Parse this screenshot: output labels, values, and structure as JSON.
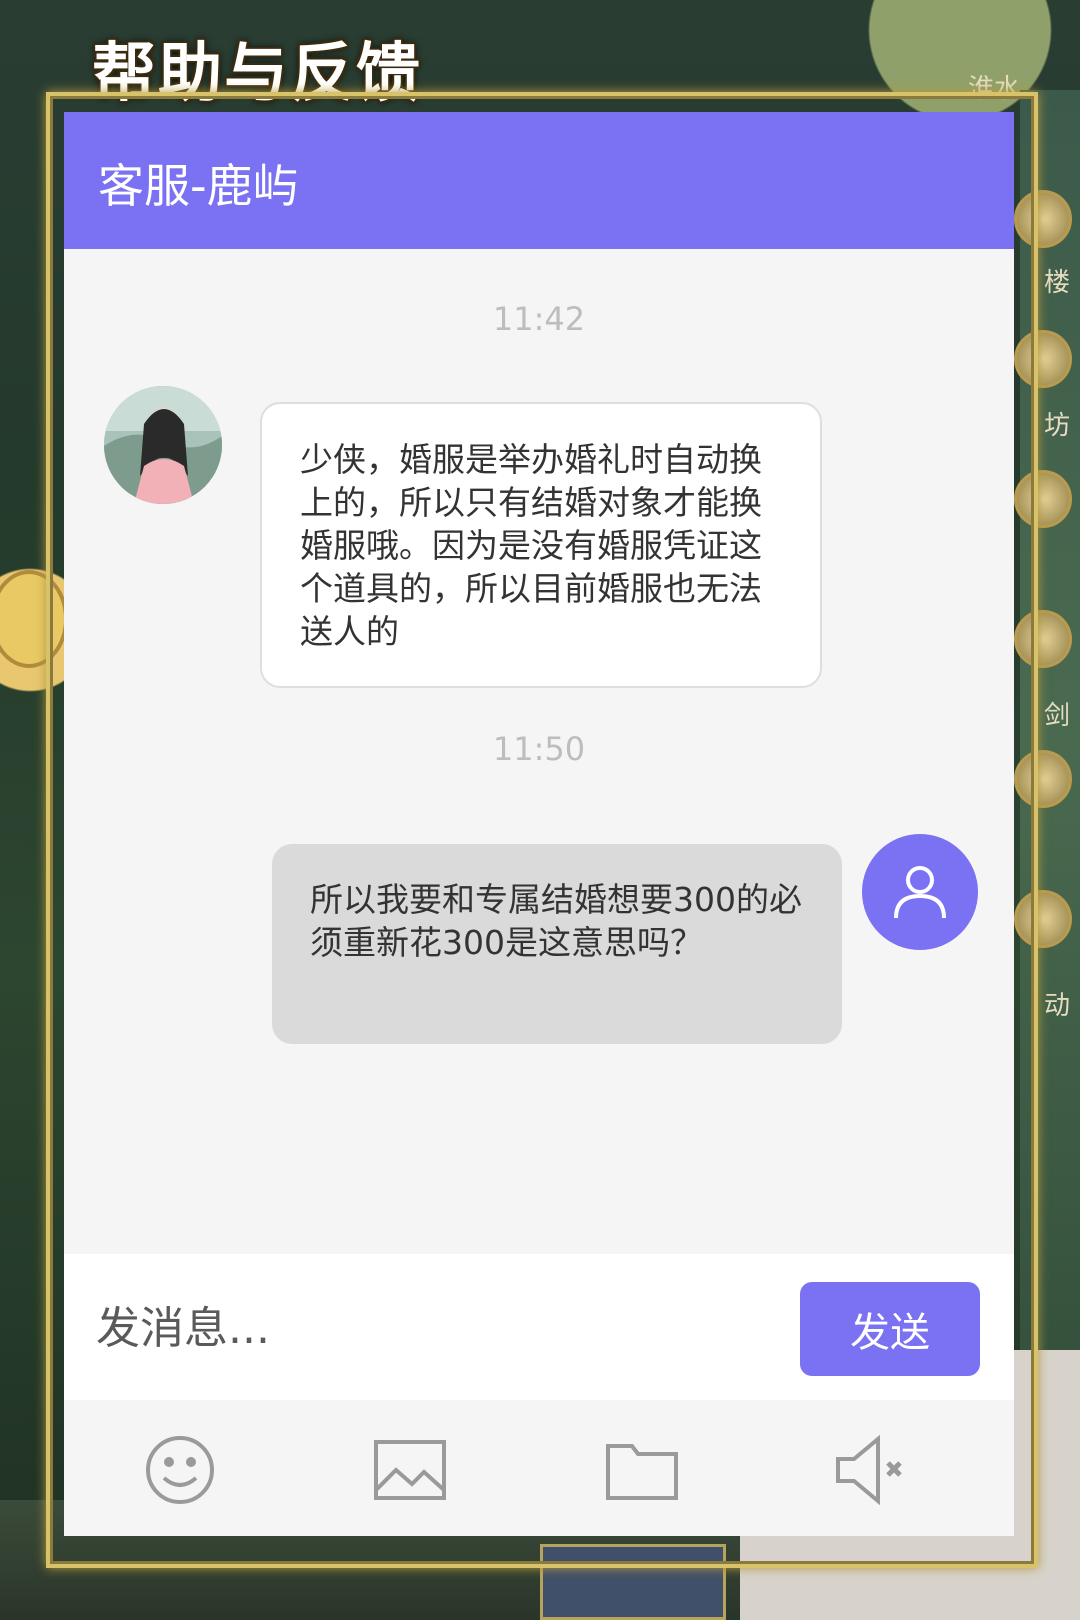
{
  "dialog": {
    "title": "帮助与反馈"
  },
  "chat": {
    "header_title": "客服-鹿屿",
    "messages": [
      {
        "time": "11:42",
        "from": "agent",
        "text": "少侠，婚服是举办婚礼时自动换上的，所以只有结婚对象才能换婚服哦。因为是没有婚服凭证这个道具的，所以目前婚服也无法送人的"
      },
      {
        "time": "11:50",
        "from": "user",
        "text": "所以我要和专属结婚想要300的必须重新花300是这意思吗？"
      }
    ],
    "input_placeholder": "发消息...",
    "send_label": "发送",
    "toolbar": [
      "emoji-icon",
      "image-icon",
      "folder-icon",
      "mute-icon"
    ]
  },
  "background": {
    "top_right_label": "淮水",
    "side_labels": [
      "楼",
      "坊",
      "剑",
      "动"
    ]
  },
  "colors": {
    "accent": "#7a72f2",
    "panel_bg": "#f5f5f5",
    "user_bubble": "#dadada",
    "agent_bubble": "#ffffff"
  }
}
